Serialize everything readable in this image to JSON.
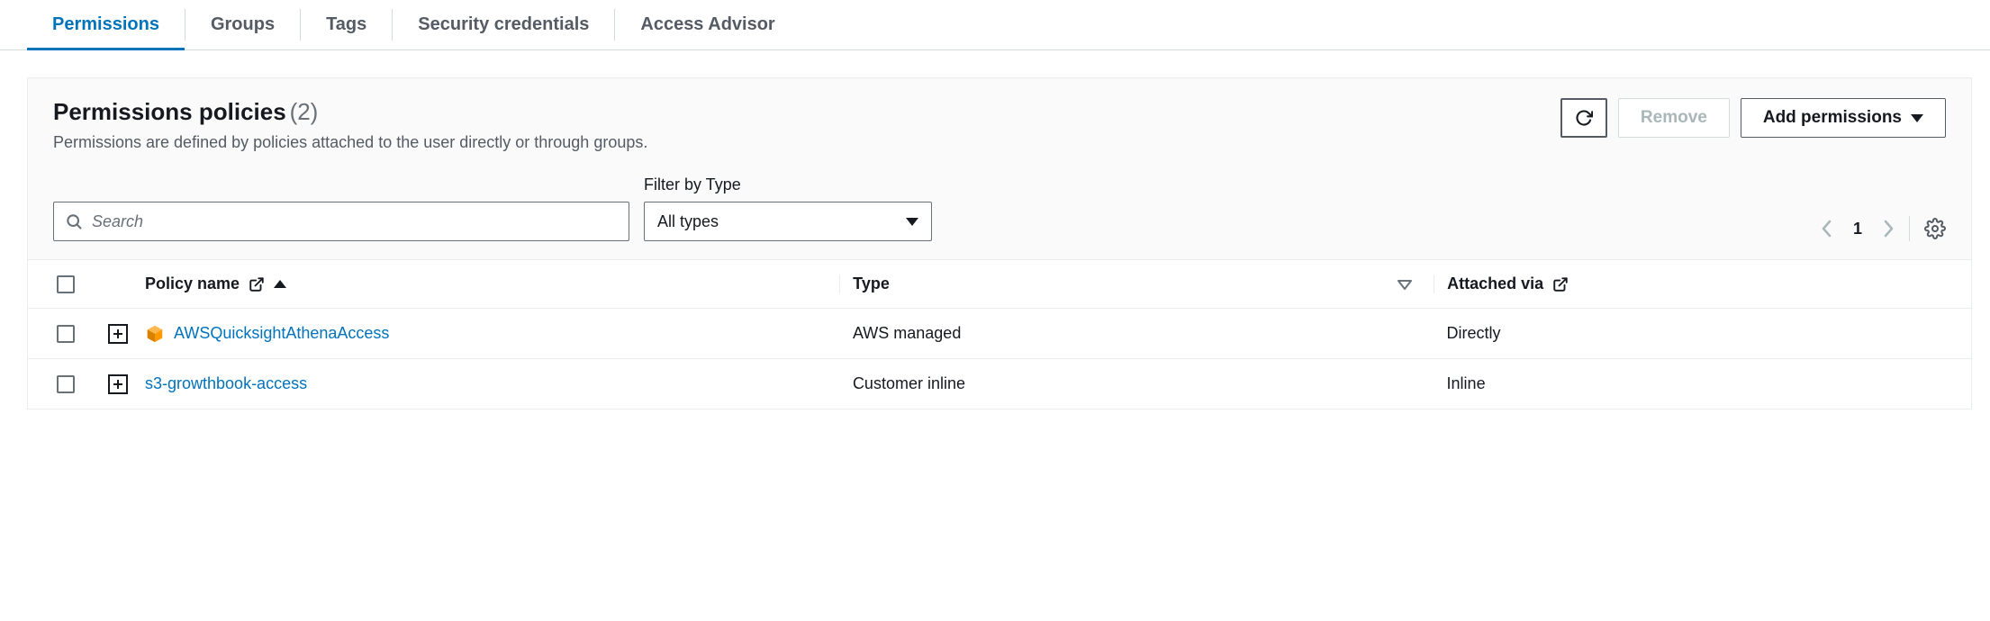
{
  "tabs": [
    {
      "label": "Permissions",
      "active": true
    },
    {
      "label": "Groups",
      "active": false
    },
    {
      "label": "Tags",
      "active": false
    },
    {
      "label": "Security credentials",
      "active": false
    },
    {
      "label": "Access Advisor",
      "active": false
    }
  ],
  "panel": {
    "title": "Permissions policies",
    "count": "(2)",
    "description": "Permissions are defined by policies attached to the user directly or through groups."
  },
  "actions": {
    "remove_label": "Remove",
    "add_label": "Add permissions"
  },
  "search": {
    "placeholder": "Search"
  },
  "filter": {
    "label": "Filter by Type",
    "value": "All types"
  },
  "pagination": {
    "page": "1"
  },
  "table": {
    "headers": {
      "name": "Policy name",
      "type": "Type",
      "via": "Attached via"
    },
    "rows": [
      {
        "name": "AWSQuicksightAthenaAccess",
        "type": "AWS managed",
        "via": "Directly",
        "aws_icon": true
      },
      {
        "name": "s3-growthbook-access",
        "type": "Customer inline",
        "via": "Inline",
        "aws_icon": false
      }
    ]
  }
}
